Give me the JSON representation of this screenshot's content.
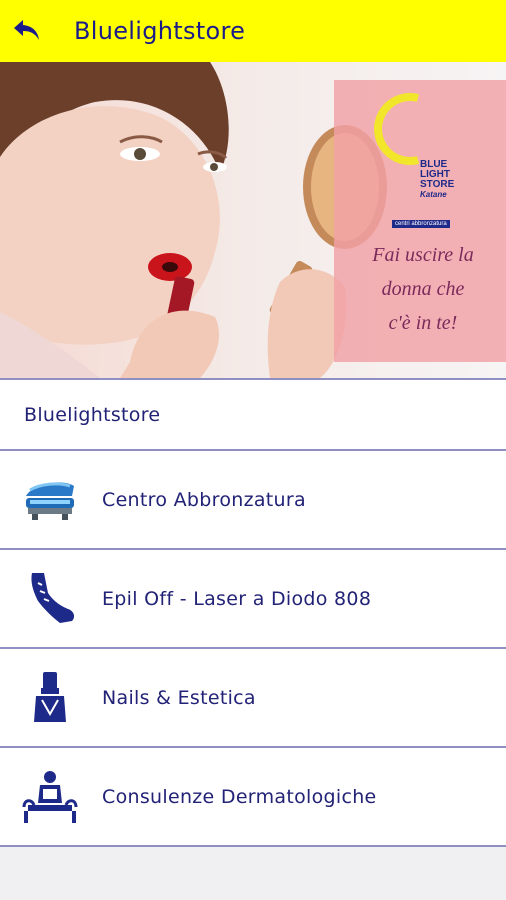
{
  "appbar": {
    "title": "Bluelightstore",
    "back_icon": "back-arrow-icon"
  },
  "hero": {
    "logo_lines": [
      "BLUE",
      "LIGHT",
      "STORE",
      "Katane"
    ],
    "logo_tagline": "centri abbronzatura",
    "slogan_lines": [
      "Fai uscire la",
      "donna che",
      "c'è in te!"
    ]
  },
  "menu": {
    "header": "Bluelightstore",
    "items": [
      {
        "label": "Centro Abbronzatura",
        "icon": "tanning-bed-icon"
      },
      {
        "label": "Epil Off - Laser a Diodo 808",
        "icon": "leg-laser-icon"
      },
      {
        "label": "Nails & Estetica",
        "icon": "nail-polish-icon"
      },
      {
        "label": "Consulenze Dermatologiche",
        "icon": "consultation-icon"
      }
    ]
  },
  "colors": {
    "appbar": "#ffff00",
    "text": "#222277",
    "divider": "#8f8fc4"
  }
}
